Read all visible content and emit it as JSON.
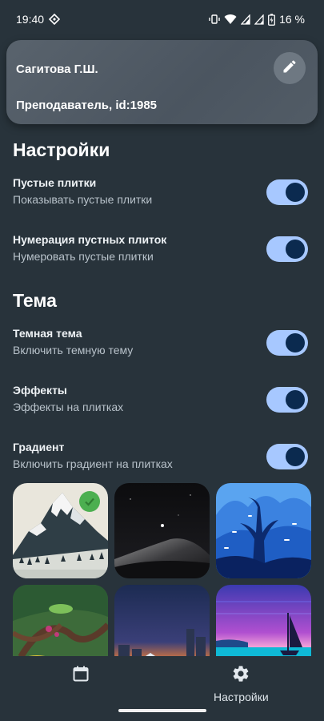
{
  "status_bar": {
    "time": "19:40",
    "battery_percent": "16 %",
    "icons": [
      "vpn-diamond-icon",
      "vibrate-icon",
      "wifi-icon",
      "signal-icon",
      "signal-icon",
      "battery-charging-icon"
    ]
  },
  "profile": {
    "name": "Сагитова Г.Ш.",
    "role": "Преподаватель, id:1985",
    "edit_icon": "pencil-icon"
  },
  "sections": {
    "settings_title": "Настройки",
    "theme_title": "Тема"
  },
  "settings": [
    {
      "title": "Пустые плитки",
      "subtitle": "Показывать пустые плитки",
      "enabled": true
    },
    {
      "title": "Нумерация пустных плиток",
      "subtitle": "Нумеровать пустые плитки",
      "enabled": true
    }
  ],
  "theme": [
    {
      "title": "Темная тема",
      "subtitle": "Включить темную тему",
      "enabled": true
    },
    {
      "title": "Эффекты",
      "subtitle": "Эффекты на плитках",
      "enabled": true
    },
    {
      "title": "Градиент",
      "subtitle": "Включить градиент на плитках",
      "enabled": true
    }
  ],
  "wallpapers": [
    {
      "name": "snowy-mountain",
      "selected": true
    },
    {
      "name": "night-dunes",
      "selected": false
    },
    {
      "name": "blue-forest",
      "selected": false
    },
    {
      "name": "jungle-vines",
      "selected": false
    },
    {
      "name": "sunset-city",
      "selected": false
    },
    {
      "name": "sailboat-sea",
      "selected": false
    }
  ],
  "bottom_nav": {
    "calendar_icon": "calendar-icon",
    "settings_icon": "gear-icon",
    "settings_label": "Настройки"
  },
  "colors": {
    "background": "#28333b",
    "toggle_track": "#a7c8ff",
    "toggle_knob": "#0b2a4f",
    "check_badge": "#4caf50"
  }
}
